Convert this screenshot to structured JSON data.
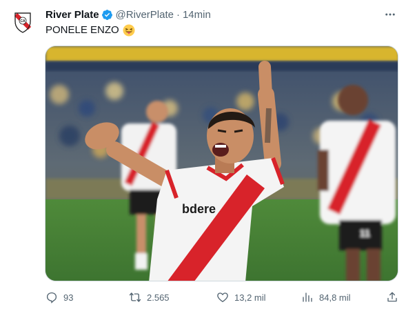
{
  "account": {
    "display_name": "River Plate",
    "handle": "@RiverPlate",
    "separator": "·",
    "time_ago": "14min",
    "avatar_icon": "river-plate-crest-icon",
    "verified_icon": "verified-badge-icon",
    "verified_color": "#1d9bf0"
  },
  "tweet": {
    "text": "PONELE ENZO",
    "emoji_icon": "tongue-wink-emoji-icon"
  },
  "media": {
    "jersey_text": "bdere",
    "description_icon": "celebrating-player-photo"
  },
  "actions": {
    "reply_count": "93",
    "retweet_count": "2.565",
    "like_count": "13,2 mil",
    "view_count": "84,8 mil"
  },
  "colors": {
    "text_primary": "#0f1419",
    "text_secondary": "#536471",
    "river_red": "#d8232a",
    "border": "#cfd9de"
  }
}
